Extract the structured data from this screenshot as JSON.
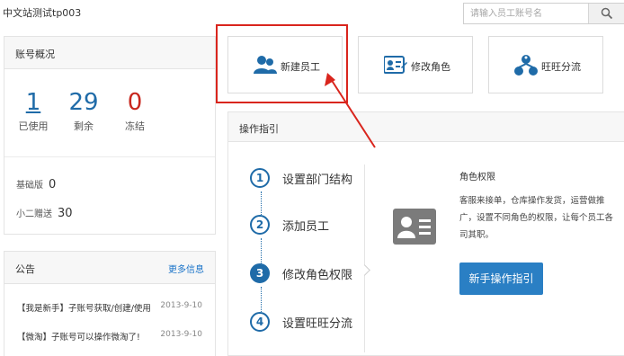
{
  "header": {
    "site_title": "中文站测试tp003",
    "search_placeholder": "请输入员工账号名"
  },
  "account_overview": {
    "title": "账号概况",
    "stats": [
      {
        "value": "1",
        "label": "已使用"
      },
      {
        "value": "29",
        "label": "剩余"
      },
      {
        "value": "0",
        "label": "冻结"
      }
    ],
    "edition_label": "基础版",
    "edition_value": "0",
    "gift_label": "小二赠送",
    "gift_value": "30"
  },
  "announcements": {
    "title": "公告",
    "more_label": "更多信息",
    "items": [
      {
        "text": "【我是新手】子账号获取/创建/使用",
        "date": "2013-9-10"
      },
      {
        "text": "【微淘】子账号可以操作微淘了!",
        "date": "2013-9-10"
      }
    ]
  },
  "actions": [
    {
      "label": "新建员工",
      "icon": "users-icon"
    },
    {
      "label": "修改角色",
      "icon": "id-card-edit-icon"
    },
    {
      "label": "旺旺分流",
      "icon": "org-chart-icon"
    }
  ],
  "guide": {
    "title": "操作指引",
    "steps": [
      {
        "number": "1",
        "label": "设置部门结构"
      },
      {
        "number": "2",
        "label": "添加员工"
      },
      {
        "number": "3",
        "label": "修改角色权限"
      },
      {
        "number": "4",
        "label": "设置旺旺分流"
      }
    ],
    "detail_title": "角色权限",
    "detail_text": "客服来接单，仓库操作发货，运营做推广，设置不同角色的权限，让每个员工各司其职。",
    "button_label": "新手操作指引"
  },
  "colors": {
    "accent_blue": "#1f6ba8",
    "button_blue": "#2a7fc4",
    "highlight_red": "#d9251d",
    "frozen_red": "#c8281f"
  }
}
